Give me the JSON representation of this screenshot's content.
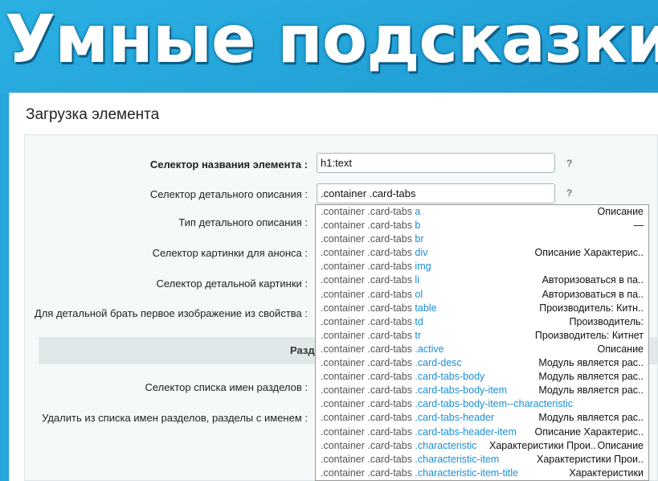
{
  "banner": {
    "title": "Умные подсказки"
  },
  "window": {
    "title": "Загрузка элемента"
  },
  "form": {
    "fields": [
      {
        "label": "Селектор названия элемента :",
        "value": "h1:text",
        "help": "?"
      },
      {
        "label": "Селектор детального описания :",
        "value": ".container .card-tabs",
        "help": "?"
      },
      {
        "label": "Тип детального описания :"
      },
      {
        "label": "Селектор картинки для анонса :"
      },
      {
        "label": "Селектор детальной картинки :"
      },
      {
        "label": "Для детальной брать первое изображение из свойства :"
      }
    ],
    "section_title": "Разд",
    "section_fields": [
      {
        "label": "Селектор списка имен разделов :"
      },
      {
        "label": "Удалить из списка имен разделов, разделы с именем :"
      }
    ]
  },
  "suggestions": [
    {
      "prefix": ".container .card-tabs ",
      "suffix": "a",
      "hint": "Описание"
    },
    {
      "prefix": ".container .card-tabs ",
      "suffix": "b",
      "hint": "—"
    },
    {
      "prefix": ".container .card-tabs ",
      "suffix": "br",
      "hint": ""
    },
    {
      "prefix": ".container .card-tabs ",
      "suffix": "div",
      "hint": "Описание Характерис.."
    },
    {
      "prefix": ".container .card-tabs ",
      "suffix": "img",
      "hint": ""
    },
    {
      "prefix": ".container .card-tabs ",
      "suffix": "li",
      "hint": "Авторизоваться в па.."
    },
    {
      "prefix": ".container .card-tabs ",
      "suffix": "ol",
      "hint": "Авторизоваться в па.."
    },
    {
      "prefix": ".container .card-tabs ",
      "suffix": "table",
      "hint": "Производитель: Китн.."
    },
    {
      "prefix": ".container .card-tabs ",
      "suffix": "td",
      "hint": "Производитель:"
    },
    {
      "prefix": ".container .card-tabs ",
      "suffix": "tr",
      "hint": "Производитель: Китнет"
    },
    {
      "prefix": ".container .card-tabs ",
      "suffix": ".active",
      "hint": "Описание"
    },
    {
      "prefix": ".container .card-tabs ",
      "suffix": ".card-desc",
      "hint": "Модуль является рас.."
    },
    {
      "prefix": ".container .card-tabs ",
      "suffix": ".card-tabs-body",
      "hint": "Модуль является рас.."
    },
    {
      "prefix": ".container .card-tabs ",
      "suffix": ".card-tabs-body-item",
      "hint": "Модуль является рас.."
    },
    {
      "prefix": ".container .card-tabs ",
      "suffix": ".card-tabs-body-item--characteristic",
      "hint": ""
    },
    {
      "prefix": ".container .card-tabs ",
      "suffix": ".card-tabs-header",
      "hint": "Модуль является рас.."
    },
    {
      "prefix": ".container .card-tabs ",
      "suffix": ".card-tabs-header-item",
      "hint": "Описание Характерис.."
    },
    {
      "prefix": ".container .card-tabs ",
      "suffix": ".characteristic",
      "hint": "Описание",
      "hint2": "Характеристики Прои.."
    },
    {
      "prefix": ".container .card-tabs ",
      "suffix": ".characteristic-item",
      "hint": "Характеристики Прои.."
    },
    {
      "prefix": ".container .card-tabs ",
      "suffix": ".characteristic-item-title",
      "hint": "Характеристики"
    }
  ]
}
